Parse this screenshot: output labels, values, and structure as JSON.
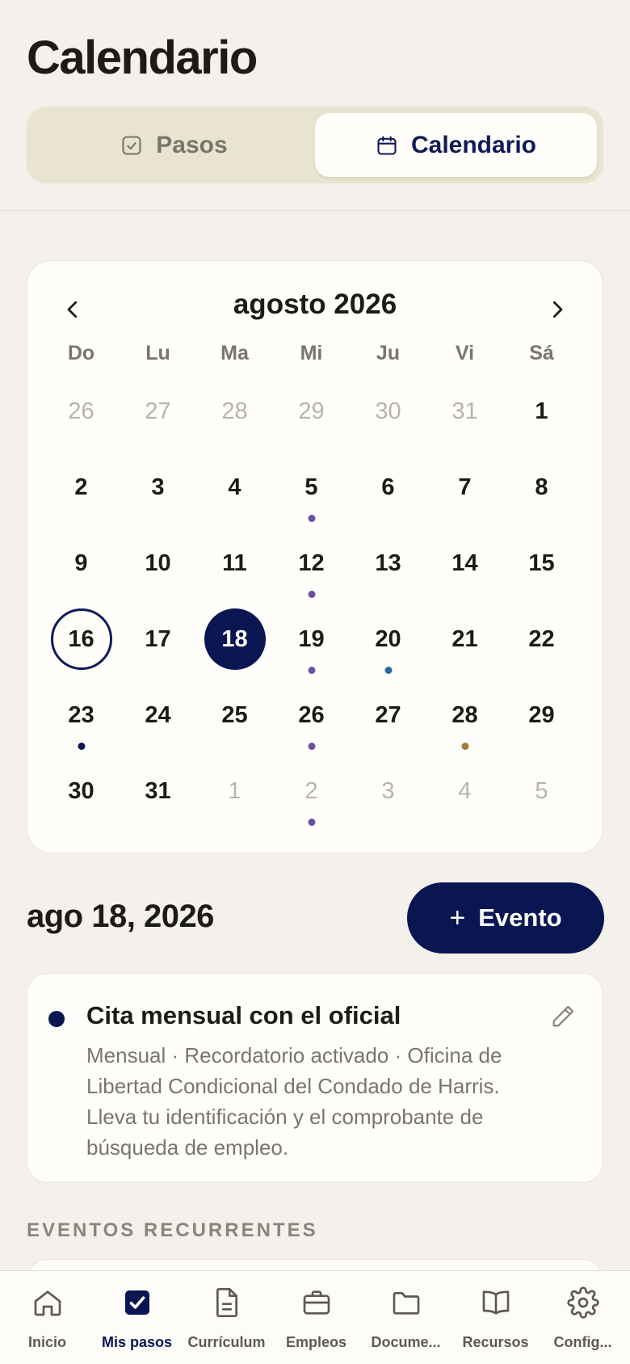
{
  "header": {
    "title": "Calendario"
  },
  "view_toggle": {
    "options": [
      {
        "label": "Pasos",
        "icon": "checkbox-icon",
        "active": false
      },
      {
        "label": "Calendario",
        "icon": "calendar-icon",
        "active": true
      }
    ]
  },
  "calendar": {
    "month_label": "agosto 2026",
    "weekdays": [
      "Do",
      "Lu",
      "Ma",
      "Mi",
      "Ju",
      "Vi",
      "Sá"
    ],
    "weeks": [
      [
        {
          "d": "26",
          "other": true
        },
        {
          "d": "27",
          "other": true
        },
        {
          "d": "28",
          "other": true
        },
        {
          "d": "29",
          "other": true
        },
        {
          "d": "30",
          "other": true
        },
        {
          "d": "31",
          "other": true
        },
        {
          "d": "1"
        }
      ],
      [
        {
          "d": "2"
        },
        {
          "d": "3"
        },
        {
          "d": "4"
        },
        {
          "d": "5",
          "dot": "#6d4fa0"
        },
        {
          "d": "6"
        },
        {
          "d": "7"
        },
        {
          "d": "8"
        }
      ],
      [
        {
          "d": "9"
        },
        {
          "d": "10"
        },
        {
          "d": "11"
        },
        {
          "d": "12",
          "dot": "#6d4fa0"
        },
        {
          "d": "13"
        },
        {
          "d": "14"
        },
        {
          "d": "15"
        }
      ],
      [
        {
          "d": "16",
          "today": true
        },
        {
          "d": "17"
        },
        {
          "d": "18",
          "selected": true
        },
        {
          "d": "19",
          "dot": "#6d4fa0"
        },
        {
          "d": "20",
          "dot": "#2b6aa6"
        },
        {
          "d": "21"
        },
        {
          "d": "22"
        }
      ],
      [
        {
          "d": "23",
          "dot": "#0a1652"
        },
        {
          "d": "24"
        },
        {
          "d": "25"
        },
        {
          "d": "26",
          "dot": "#6d4fa0"
        },
        {
          "d": "27"
        },
        {
          "d": "28",
          "dot": "#a87a3a"
        },
        {
          "d": "29"
        }
      ],
      [
        {
          "d": "30"
        },
        {
          "d": "31"
        },
        {
          "d": "1",
          "other": true
        },
        {
          "d": "2",
          "other": true,
          "dot": "#6d4fa0"
        },
        {
          "d": "3",
          "other": true
        },
        {
          "d": "4",
          "other": true
        },
        {
          "d": "5",
          "other": true
        }
      ]
    ]
  },
  "selected_day": {
    "date_label": "ago 18, 2026",
    "add_button_label": "Evento",
    "events": [
      {
        "title": "Cita mensual con el oficial",
        "description": "Mensual · Recordatorio activado · Oficina de Libertad Condicional del Condado de Harris. Lleva tu identificación y el comprobante de búsqueda de empleo.",
        "dot_color": "#0a1652"
      }
    ]
  },
  "recurring": {
    "section_label": "EVENTOS RECURRENTES"
  },
  "bottom_nav": {
    "items": [
      {
        "label": "Inicio",
        "icon": "home-icon",
        "active": false
      },
      {
        "label": "Mis pasos",
        "icon": "checkbox-icon",
        "active": true
      },
      {
        "label": "Currículum",
        "icon": "document-icon",
        "active": false
      },
      {
        "label": "Empleos",
        "icon": "briefcase-icon",
        "active": false
      },
      {
        "label": "Docume...",
        "icon": "folder-icon",
        "active": false
      },
      {
        "label": "Recursos",
        "icon": "book-icon",
        "active": false
      },
      {
        "label": "Config...",
        "icon": "gear-icon",
        "active": false
      }
    ]
  },
  "colors": {
    "navy": "#0a1652",
    "background": "#f4f0eb",
    "muted": "#7a756c"
  }
}
